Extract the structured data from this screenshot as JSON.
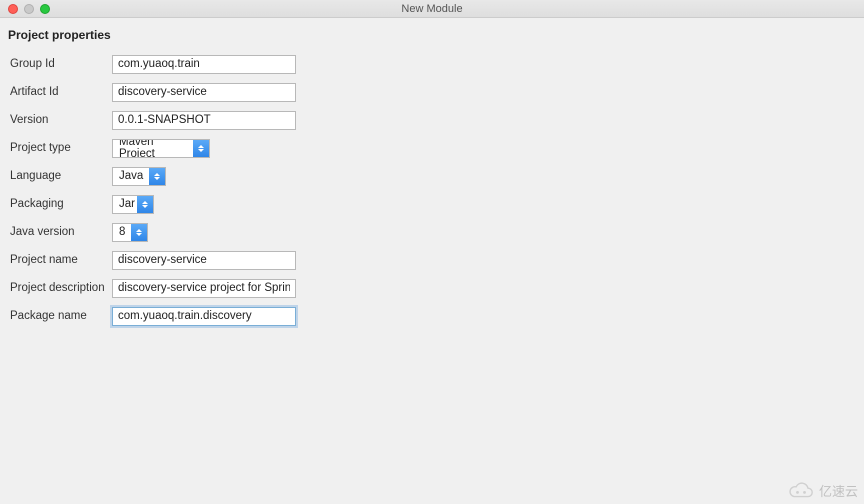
{
  "window": {
    "title": "New Module"
  },
  "sectionTitle": "Project properties",
  "labels": {
    "groupId": "Group Id",
    "artifactId": "Artifact Id",
    "version": "Version",
    "projectType": "Project type",
    "language": "Language",
    "packaging": "Packaging",
    "javaVersion": "Java version",
    "projectName": "Project name",
    "projectDescription": "Project description",
    "packageName": "Package name"
  },
  "values": {
    "groupId": "com.yuaoq.train",
    "artifactId": "discovery-service",
    "version": "0.0.1-SNAPSHOT",
    "projectType": "Maven Project",
    "language": "Java",
    "packaging": "Jar",
    "javaVersion": "8",
    "projectName": "discovery-service",
    "projectDescription": "discovery-service project for Sprin",
    "packageName": "com.yuaoq.train.discovery"
  },
  "watermark": "亿速云"
}
